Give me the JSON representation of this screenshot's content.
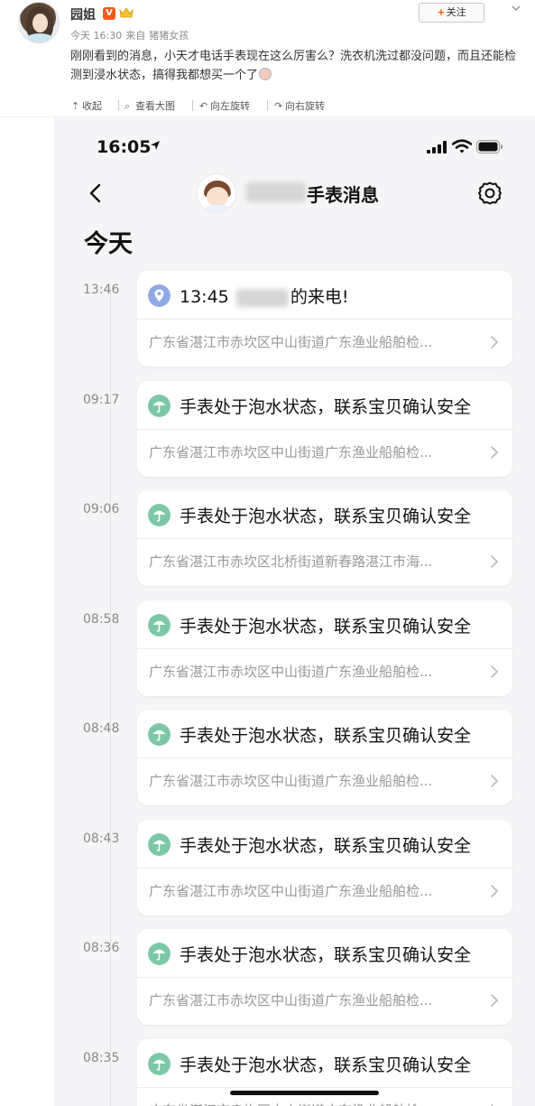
{
  "post": {
    "username": "园姐",
    "verified_badge": "V",
    "meta_time": "今天 16:30",
    "meta_from": "来自",
    "meta_source": "猪猪女孩",
    "follow_label": "关注",
    "text": "刚刚看到的消息，小天才电话手表现在这么厉害么？洗衣机洗过都没问题，而且还能检测到浸水状态，搞得我都想买一个了"
  },
  "toolbar": {
    "collapse": "收起",
    "view_large": "查看大图",
    "rotate_left": "向左旋转",
    "rotate_right": "向右旋转"
  },
  "phone": {
    "status_time": "16:05",
    "nav_title": "手表消息",
    "section_title": "今天",
    "entries": [
      {
        "time": "13:46",
        "title_prefix": "13:45",
        "title_suffix": "的来电!",
        "address": "广东省湛江市赤坎区中山街道广东渔业船舶检...",
        "icon": "call-location-icon"
      },
      {
        "time": "09:17",
        "title": "手表处于泡水状态，联系宝贝确认安全",
        "address": "广东省湛江市赤坎区中山街道广东渔业船舶检...",
        "icon": "umbrella-icon"
      },
      {
        "time": "09:06",
        "title": "手表处于泡水状态，联系宝贝确认安全",
        "address": "广东省湛江市赤坎区北桥街道新春路湛江市海...",
        "icon": "umbrella-icon"
      },
      {
        "time": "08:58",
        "title": "手表处于泡水状态，联系宝贝确认安全",
        "address": "广东省湛江市赤坎区中山街道广东渔业船舶检...",
        "icon": "umbrella-icon"
      },
      {
        "time": "08:48",
        "title": "手表处于泡水状态，联系宝贝确认安全",
        "address": "广东省湛江市赤坎区中山街道广东渔业船舶检...",
        "icon": "umbrella-icon"
      },
      {
        "time": "08:43",
        "title": "手表处于泡水状态，联系宝贝确认安全",
        "address": "广东省湛江市赤坎区中山街道广东渔业船舶检...",
        "icon": "umbrella-icon"
      },
      {
        "time": "08:36",
        "title": "手表处于泡水状态，联系宝贝确认安全",
        "address": "广东省湛江市赤坎区中山街道广东渔业船舶检...",
        "icon": "umbrella-icon"
      },
      {
        "time": "08:35",
        "title": "手表处于泡水状态，联系宝贝确认安全",
        "address": "广东省湛江市赤坎区中山街道广东渔业船舶检...",
        "icon": "umbrella-icon"
      }
    ]
  },
  "colors": {
    "accent_orange": "#f25c05",
    "umbrella_green": "#7cc7a6",
    "location_blue": "#8fa9e6",
    "phone_bg": "#f5f5f7"
  }
}
